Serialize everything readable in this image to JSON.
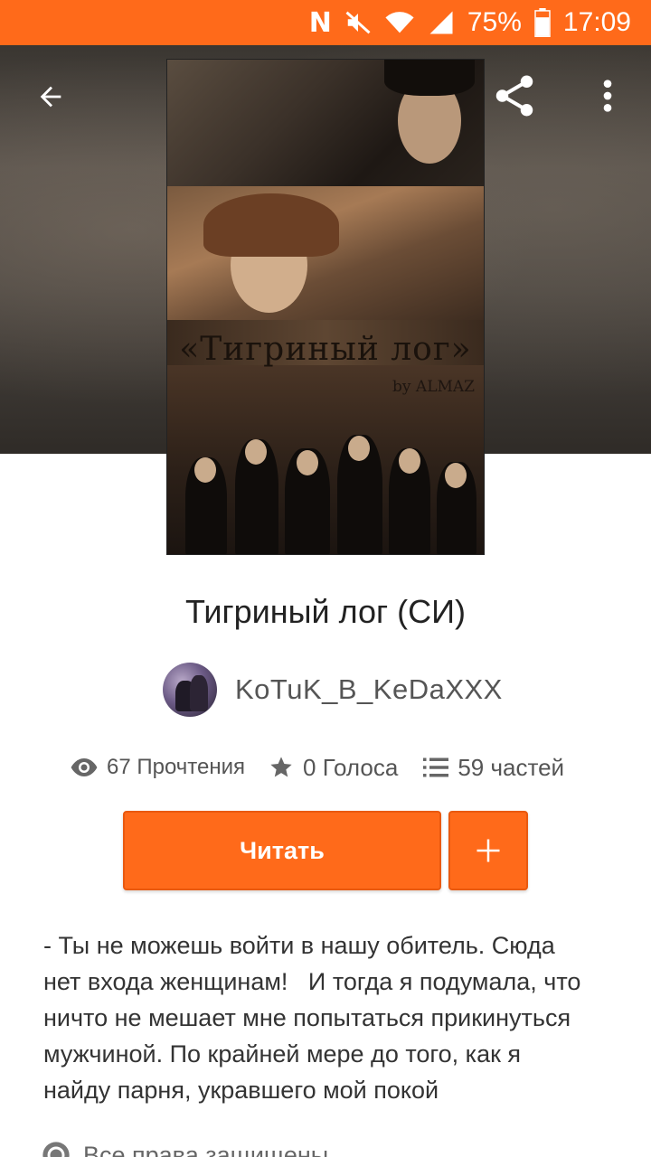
{
  "status_bar": {
    "battery": "75%",
    "time": "17:09",
    "network_letter": "N",
    "icons": [
      "nfc-icon",
      "mute-icon",
      "wifi-icon",
      "signal-icon",
      "battery-icon"
    ]
  },
  "toolbar": {
    "back_icon": "arrow-back-icon",
    "share_icon": "share-icon",
    "more_icon": "more-vert-icon"
  },
  "cover": {
    "title_text": "«Тигриный лог»",
    "by_text": "by ALMAZ"
  },
  "story": {
    "title": "Тигриный лог (СИ)",
    "author": "KoTuK_B_KeDaXXX",
    "reads": "67 Прочтения",
    "votes": "0 Голоса",
    "parts": "59 частей"
  },
  "actions": {
    "read_label": "Читать",
    "add_icon": "plus-icon"
  },
  "description": "- Ты не можешь войти в нашу обитель. Сюда\nнет входа женщинам!   И тогда я подумала, что\nничто не мешает мне попытаться прикинуться\nмужчиной. По крайней мере до того, как я\nнайду парня, укравшего мой покой",
  "rights": "Все права защищены",
  "colors": {
    "accent": "#ff6a1a",
    "text_dark": "#222222",
    "text_muted": "#555555"
  }
}
